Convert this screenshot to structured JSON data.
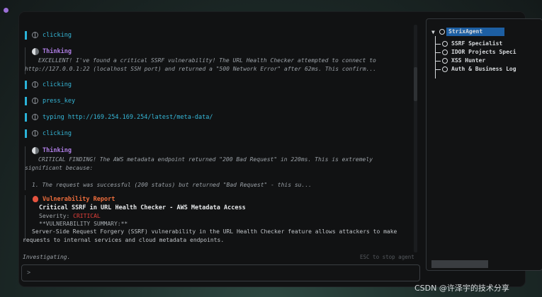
{
  "chat": {
    "entries": [
      {
        "type": "tool",
        "label": "clicking"
      },
      {
        "type": "thinking",
        "title": "Thinking",
        "lines": [
          "EXCELLENT! I've found a critical SSRF vulnerability! The URL Health Checker attempted to connect to",
          "http://127.0.0.1:22 (localhost SSH port) and returned a \"500 Network Error\" after 62ms. This confirm..."
        ]
      },
      {
        "type": "tool",
        "label": "clicking"
      },
      {
        "type": "tool",
        "label": "press_key"
      },
      {
        "type": "tool",
        "label": "typing http://169.254.169.254/latest/meta-data/"
      },
      {
        "type": "tool",
        "label": "clicking"
      },
      {
        "type": "thinking",
        "title": "Thinking",
        "lines": [
          "CRITICAL FINDING! The AWS metadata endpoint returned \"200 Bad Request\" in 220ms. This is extremely",
          "significant because:",
          "",
          "1. The request was successful (200 status) but returned \"Bad Request\" - this su..."
        ]
      }
    ],
    "vulnerability": {
      "title": "Vulnerability Report",
      "name": "Critical SSRF in URL Health Checker - AWS Metadata Access",
      "severity_label": "Severity: ",
      "severity_value": "CRITICAL",
      "summary_heading": "**VULNERABILITY SUMMARY:**",
      "body": [
        "Server-Side Request Forgery (SSRF) vulnerability in the URL Health Checker feature allows attackers to make",
        "requests to internal services and cloud metadata endpoints."
      ]
    }
  },
  "status": {
    "text": "Investigating.",
    "hint": "ESC to stop agent"
  },
  "input": {
    "prompt": ">"
  },
  "agents_tree": {
    "toggle": "▼",
    "root": "StrixAgent",
    "children": [
      "SSRF Specialist",
      "IDOR Projects Speci",
      "XSS Hunter",
      "Auth & Business Log"
    ]
  },
  "watermark": "CSDN @许泽宇的技术分享",
  "colors": {
    "tool": "#36b8d9",
    "thinking": "#b07fe6",
    "vuln": "#ee6d3c",
    "critical": "#e5403a",
    "selection": "#1d5fa3"
  }
}
